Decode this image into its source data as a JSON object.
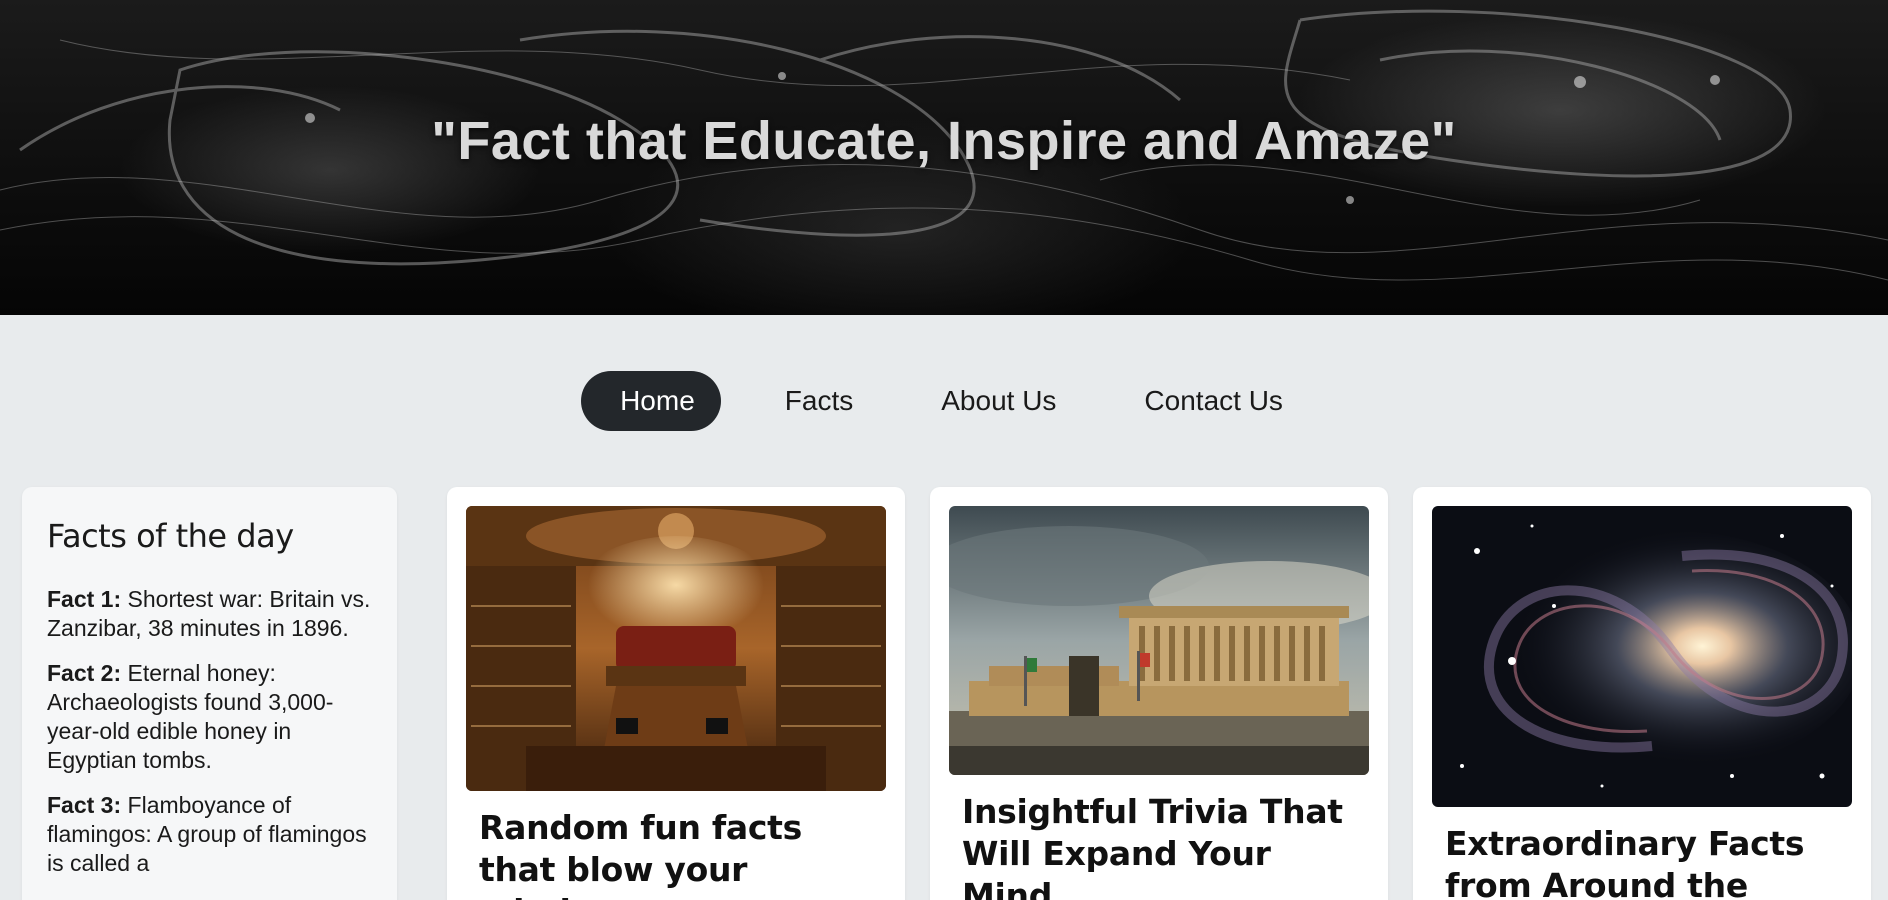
{
  "hero": {
    "title": "\"Fact that Educate, Inspire and Amaze\""
  },
  "nav": {
    "items": [
      {
        "label": "Home",
        "active": true
      },
      {
        "label": "Facts",
        "active": false
      },
      {
        "label": "About Us",
        "active": false
      },
      {
        "label": "Contact Us",
        "active": false
      }
    ]
  },
  "sidebar": {
    "title": "Facts of the day",
    "facts": [
      {
        "label": "Fact 1:",
        "text": " Shortest war: Britain vs. Zanzibar, 38 minutes in 1896."
      },
      {
        "label": "Fact 2:",
        "text": " Eternal honey: Archaeologists found 3,000-year-old edible honey in Egyptian tombs."
      },
      {
        "label": "Fact 3:",
        "text": " Flamboyance of flamingos: A group of flamingos is called a"
      }
    ]
  },
  "cards": [
    {
      "title": "Random fun facts that blow your mind...",
      "image": "library-interior-photo"
    },
    {
      "title": "Insightful Trivia That Will Expand Your Mind...",
      "image": "monument-building-photo"
    },
    {
      "title": "Extraordinary Facts from Around the",
      "image": "spiral-galaxy-photo"
    }
  ],
  "colors": {
    "page_bg": "#e8ebed",
    "nav_active_bg": "#23272b",
    "hero_text": "#d9d9d9"
  }
}
